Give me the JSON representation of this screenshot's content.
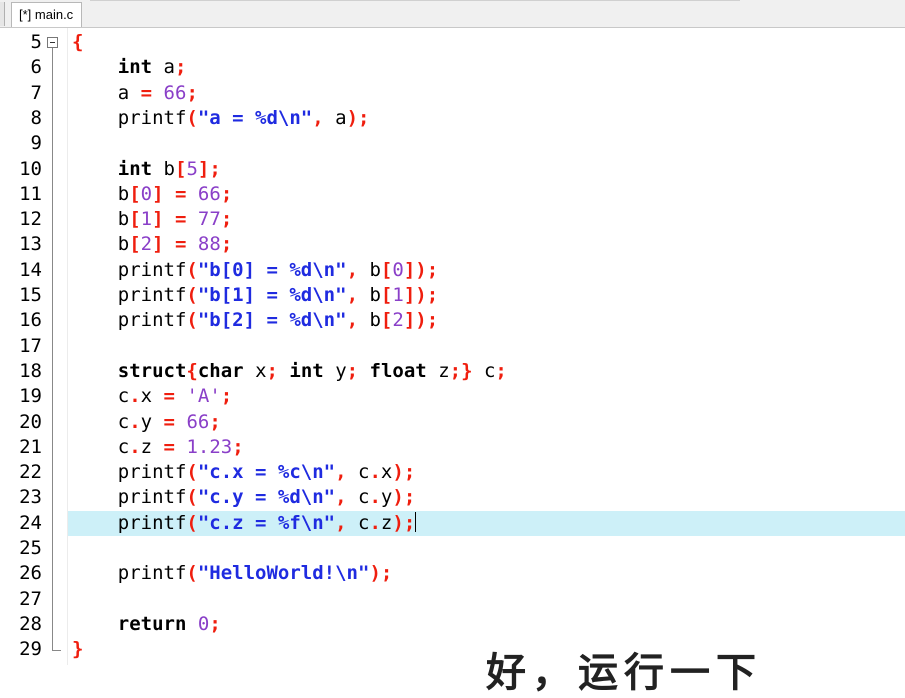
{
  "tab": {
    "title": "[*] main.c"
  },
  "editor": {
    "current_line": 24,
    "lines": [
      {
        "n": "5",
        "tokens": [
          [
            "op",
            "{"
          ]
        ]
      },
      {
        "n": "6",
        "tokens": [
          [
            "id",
            "    "
          ],
          [
            "kw",
            "int"
          ],
          [
            "id",
            " a"
          ],
          [
            "op",
            ";"
          ]
        ]
      },
      {
        "n": "7",
        "tokens": [
          [
            "id",
            "    a "
          ],
          [
            "op",
            "="
          ],
          [
            "id",
            " "
          ],
          [
            "num",
            "66"
          ],
          [
            "op",
            ";"
          ]
        ]
      },
      {
        "n": "8",
        "tokens": [
          [
            "id",
            "    printf"
          ],
          [
            "op",
            "("
          ],
          [
            "str",
            "\"a = %d\\n\""
          ],
          [
            "op",
            ","
          ],
          [
            "id",
            " a"
          ],
          [
            "op",
            ");"
          ]
        ]
      },
      {
        "n": "9",
        "tokens": []
      },
      {
        "n": "10",
        "tokens": [
          [
            "id",
            "    "
          ],
          [
            "kw",
            "int"
          ],
          [
            "id",
            " b"
          ],
          [
            "op",
            "["
          ],
          [
            "num",
            "5"
          ],
          [
            "op",
            "];"
          ]
        ]
      },
      {
        "n": "11",
        "tokens": [
          [
            "id",
            "    b"
          ],
          [
            "op",
            "["
          ],
          [
            "num",
            "0"
          ],
          [
            "op",
            "]"
          ],
          [
            "id",
            " "
          ],
          [
            "op",
            "="
          ],
          [
            "id",
            " "
          ],
          [
            "num",
            "66"
          ],
          [
            "op",
            ";"
          ]
        ]
      },
      {
        "n": "12",
        "tokens": [
          [
            "id",
            "    b"
          ],
          [
            "op",
            "["
          ],
          [
            "num",
            "1"
          ],
          [
            "op",
            "]"
          ],
          [
            "id",
            " "
          ],
          [
            "op",
            "="
          ],
          [
            "id",
            " "
          ],
          [
            "num",
            "77"
          ],
          [
            "op",
            ";"
          ]
        ]
      },
      {
        "n": "13",
        "tokens": [
          [
            "id",
            "    b"
          ],
          [
            "op",
            "["
          ],
          [
            "num",
            "2"
          ],
          [
            "op",
            "]"
          ],
          [
            "id",
            " "
          ],
          [
            "op",
            "="
          ],
          [
            "id",
            " "
          ],
          [
            "num",
            "88"
          ],
          [
            "op",
            ";"
          ]
        ]
      },
      {
        "n": "14",
        "tokens": [
          [
            "id",
            "    printf"
          ],
          [
            "op",
            "("
          ],
          [
            "str",
            "\"b[0] = %d\\n\""
          ],
          [
            "op",
            ","
          ],
          [
            "id",
            " b"
          ],
          [
            "op",
            "["
          ],
          [
            "num",
            "0"
          ],
          [
            "op",
            "]);"
          ]
        ]
      },
      {
        "n": "15",
        "tokens": [
          [
            "id",
            "    printf"
          ],
          [
            "op",
            "("
          ],
          [
            "str",
            "\"b[1] = %d\\n\""
          ],
          [
            "op",
            ","
          ],
          [
            "id",
            " b"
          ],
          [
            "op",
            "["
          ],
          [
            "num",
            "1"
          ],
          [
            "op",
            "]);"
          ]
        ]
      },
      {
        "n": "16",
        "tokens": [
          [
            "id",
            "    printf"
          ],
          [
            "op",
            "("
          ],
          [
            "str",
            "\"b[2] = %d\\n\""
          ],
          [
            "op",
            ","
          ],
          [
            "id",
            " b"
          ],
          [
            "op",
            "["
          ],
          [
            "num",
            "2"
          ],
          [
            "op",
            "]);"
          ]
        ]
      },
      {
        "n": "17",
        "tokens": []
      },
      {
        "n": "18",
        "tokens": [
          [
            "id",
            "    "
          ],
          [
            "kw",
            "struct"
          ],
          [
            "op",
            "{"
          ],
          [
            "kw",
            "char"
          ],
          [
            "id",
            " x"
          ],
          [
            "op",
            ";"
          ],
          [
            "id",
            " "
          ],
          [
            "kw",
            "int"
          ],
          [
            "id",
            " y"
          ],
          [
            "op",
            ";"
          ],
          [
            "id",
            " "
          ],
          [
            "kw",
            "float"
          ],
          [
            "id",
            " z"
          ],
          [
            "op",
            ";}"
          ],
          [
            "id",
            " c"
          ],
          [
            "op",
            ";"
          ]
        ]
      },
      {
        "n": "19",
        "tokens": [
          [
            "id",
            "    c"
          ],
          [
            "op",
            "."
          ],
          [
            "id",
            "x "
          ],
          [
            "op",
            "="
          ],
          [
            "id",
            " "
          ],
          [
            "num",
            "'A'"
          ],
          [
            "op",
            ";"
          ]
        ]
      },
      {
        "n": "20",
        "tokens": [
          [
            "id",
            "    c"
          ],
          [
            "op",
            "."
          ],
          [
            "id",
            "y "
          ],
          [
            "op",
            "="
          ],
          [
            "id",
            " "
          ],
          [
            "num",
            "66"
          ],
          [
            "op",
            ";"
          ]
        ]
      },
      {
        "n": "21",
        "tokens": [
          [
            "id",
            "    c"
          ],
          [
            "op",
            "."
          ],
          [
            "id",
            "z "
          ],
          [
            "op",
            "="
          ],
          [
            "id",
            " "
          ],
          [
            "num",
            "1.23"
          ],
          [
            "op",
            ";"
          ]
        ]
      },
      {
        "n": "22",
        "tokens": [
          [
            "id",
            "    printf"
          ],
          [
            "op",
            "("
          ],
          [
            "str",
            "\"c.x = %c\\n\""
          ],
          [
            "op",
            ","
          ],
          [
            "id",
            " c"
          ],
          [
            "op",
            "."
          ],
          [
            "id",
            "x"
          ],
          [
            "op",
            ");"
          ]
        ]
      },
      {
        "n": "23",
        "tokens": [
          [
            "id",
            "    printf"
          ],
          [
            "op",
            "("
          ],
          [
            "str",
            "\"c.y = %d\\n\""
          ],
          [
            "op",
            ","
          ],
          [
            "id",
            " c"
          ],
          [
            "op",
            "."
          ],
          [
            "id",
            "y"
          ],
          [
            "op",
            ");"
          ]
        ]
      },
      {
        "n": "24",
        "tokens": [
          [
            "id",
            "    printf"
          ],
          [
            "op",
            "("
          ],
          [
            "str",
            "\"c.z = %f\\n\""
          ],
          [
            "op",
            ","
          ],
          [
            "id",
            " c"
          ],
          [
            "op",
            "."
          ],
          [
            "id",
            "z"
          ],
          [
            "op",
            ");"
          ]
        ]
      },
      {
        "n": "25",
        "tokens": []
      },
      {
        "n": "26",
        "tokens": [
          [
            "id",
            "    printf"
          ],
          [
            "op",
            "("
          ],
          [
            "str",
            "\"HelloWorld!\\n\""
          ],
          [
            "op",
            ");"
          ]
        ]
      },
      {
        "n": "27",
        "tokens": []
      },
      {
        "n": "28",
        "tokens": [
          [
            "id",
            "    "
          ],
          [
            "kw",
            "return"
          ],
          [
            "id",
            " "
          ],
          [
            "num",
            "0"
          ],
          [
            "op",
            ";"
          ]
        ]
      },
      {
        "n": "29",
        "tokens": [
          [
            "op",
            "}"
          ]
        ]
      }
    ]
  },
  "overlay": {
    "subtitle": "好，运行一下"
  },
  "colors": {
    "keyword": "#000000",
    "number": "#8a3fc8",
    "string": "#1f2be0",
    "operator": "#ef1e0e",
    "current_line_bg": "#cdf0f8"
  }
}
